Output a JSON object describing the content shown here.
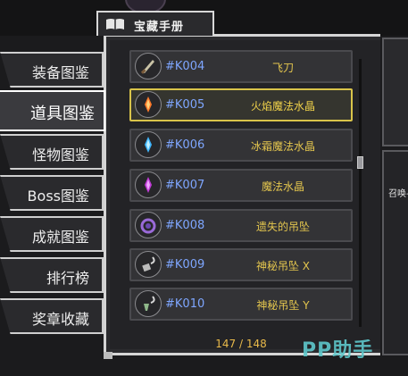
{
  "header": {
    "title": "宝藏手册",
    "book_icon": "book-icon"
  },
  "menu": [
    {
      "label": "装备图鉴",
      "active": false
    },
    {
      "label": "道具图鉴",
      "active": true
    },
    {
      "label": "怪物图鉴",
      "active": false
    },
    {
      "label": "Boss图鉴",
      "active": false
    },
    {
      "label": "成就图鉴",
      "active": false
    },
    {
      "label": "排行榜",
      "active": false
    },
    {
      "label": "奖章收藏",
      "active": false
    }
  ],
  "items": [
    {
      "code": "#K004",
      "name": "飞刀",
      "icon": "knife-icon",
      "selected": false
    },
    {
      "code": "#K005",
      "name": "火焰魔法水晶",
      "icon": "fire-crystal-icon",
      "selected": true
    },
    {
      "code": "#K006",
      "name": "冰霜魔法水晶",
      "icon": "ice-crystal-icon",
      "selected": false
    },
    {
      "code": "#K007",
      "name": "魔法水晶",
      "icon": "magic-crystal-icon",
      "selected": false
    },
    {
      "code": "#K008",
      "name": "遗失的吊坠",
      "icon": "lost-pendant-icon",
      "selected": false
    },
    {
      "code": "#K009",
      "name": "神秘吊坠 X",
      "icon": "pendant-x-icon",
      "selected": false
    },
    {
      "code": "#K010",
      "name": "神秘吊坠 Y",
      "icon": "pendant-y-icon",
      "selected": false
    }
  ],
  "progress": {
    "text": "147 / 148"
  },
  "detail": {
    "label": "召唤-"
  },
  "watermark": "PP助手",
  "colors": {
    "code": "#7ea6ff",
    "name": "#e4c64e",
    "selected_border": "#d9c44a",
    "count": "#e8b94a"
  }
}
